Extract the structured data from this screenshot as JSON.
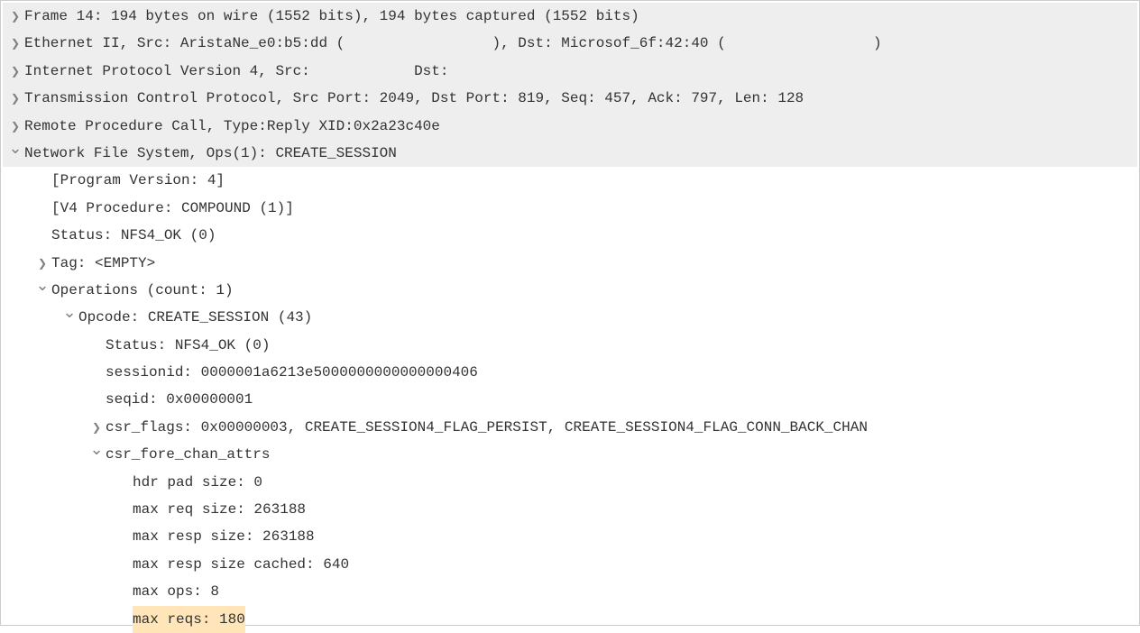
{
  "rows": [
    {
      "id": "frame",
      "level": 0,
      "expander": "collapsed",
      "shaded": true,
      "highlighted": false,
      "text": "Frame 14: 194 bytes on wire (1552 bits), 194 bytes captured (1552 bits)"
    },
    {
      "id": "ethernet",
      "level": 0,
      "expander": "collapsed",
      "shaded": true,
      "highlighted": false,
      "text": "Ethernet II, Src: AristaNe_e0:b5:dd (                 ), Dst: Microsof_6f:42:40 (                 )"
    },
    {
      "id": "ipv4",
      "level": 0,
      "expander": "collapsed",
      "shaded": true,
      "highlighted": false,
      "text": "Internet Protocol Version 4, Src:            Dst:"
    },
    {
      "id": "tcp",
      "level": 0,
      "expander": "collapsed",
      "shaded": true,
      "highlighted": false,
      "text": "Transmission Control Protocol, Src Port: 2049, Dst Port: 819, Seq: 457, Ack: 797, Len: 128"
    },
    {
      "id": "rpc",
      "level": 0,
      "expander": "collapsed",
      "shaded": true,
      "highlighted": false,
      "text": "Remote Procedure Call, Type:Reply XID:0x2a23c40e"
    },
    {
      "id": "nfs",
      "level": 0,
      "expander": "expanded",
      "shaded": true,
      "highlighted": false,
      "text": "Network File System, Ops(1): CREATE_SESSION"
    },
    {
      "id": "prog-version",
      "level": 1,
      "expander": "none",
      "shaded": false,
      "highlighted": false,
      "text": "[Program Version: 4]"
    },
    {
      "id": "v4-procedure",
      "level": 1,
      "expander": "none",
      "shaded": false,
      "highlighted": false,
      "text": "[V4 Procedure: COMPOUND (1)]"
    },
    {
      "id": "status",
      "level": 1,
      "expander": "none",
      "shaded": false,
      "highlighted": false,
      "text": "Status: NFS4_OK (0)"
    },
    {
      "id": "tag",
      "level": 1,
      "expander": "collapsed",
      "shaded": false,
      "highlighted": false,
      "text": "Tag: <EMPTY>"
    },
    {
      "id": "operations",
      "level": 1,
      "expander": "expanded",
      "shaded": false,
      "highlighted": false,
      "text": "Operations (count: 1)"
    },
    {
      "id": "opcode",
      "level": 2,
      "expander": "expanded",
      "shaded": false,
      "highlighted": false,
      "text": "Opcode: CREATE_SESSION (43)"
    },
    {
      "id": "op-status",
      "level": 3,
      "expander": "none",
      "shaded": false,
      "highlighted": false,
      "text": "Status: NFS4_OK (0)"
    },
    {
      "id": "sessionid",
      "level": 3,
      "expander": "none",
      "shaded": false,
      "highlighted": false,
      "text": "sessionid: 0000001a6213e5000000000000000406"
    },
    {
      "id": "seqid",
      "level": 3,
      "expander": "none",
      "shaded": false,
      "highlighted": false,
      "text": "seqid: 0x00000001"
    },
    {
      "id": "csr-flags",
      "level": 3,
      "expander": "collapsed",
      "shaded": false,
      "highlighted": false,
      "text": "csr_flags: 0x00000003, CREATE_SESSION4_FLAG_PERSIST, CREATE_SESSION4_FLAG_CONN_BACK_CHAN"
    },
    {
      "id": "csr-fore-chan",
      "level": 3,
      "expander": "expanded",
      "shaded": false,
      "highlighted": false,
      "text": "csr_fore_chan_attrs"
    },
    {
      "id": "hdr-pad",
      "level": 4,
      "expander": "none",
      "shaded": false,
      "highlighted": false,
      "text": "hdr pad size: 0"
    },
    {
      "id": "max-req-size",
      "level": 4,
      "expander": "none",
      "shaded": false,
      "highlighted": false,
      "text": "max req size: 263188"
    },
    {
      "id": "max-resp-size",
      "level": 4,
      "expander": "none",
      "shaded": false,
      "highlighted": false,
      "text": "max resp size: 263188"
    },
    {
      "id": "max-resp-cached",
      "level": 4,
      "expander": "none",
      "shaded": false,
      "highlighted": false,
      "text": "max resp size cached: 640"
    },
    {
      "id": "max-ops",
      "level": 4,
      "expander": "none",
      "shaded": false,
      "highlighted": false,
      "text": "max ops: 8"
    },
    {
      "id": "max-reqs",
      "level": 4,
      "expander": "none",
      "shaded": false,
      "highlighted": true,
      "text": "max reqs: 180"
    }
  ]
}
